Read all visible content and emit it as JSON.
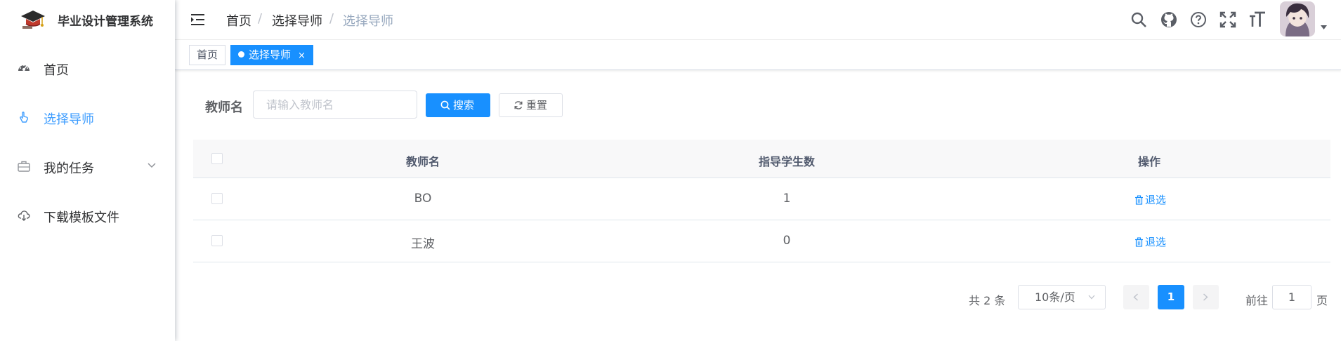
{
  "app": {
    "title": "毕业设计管理系统"
  },
  "sidebar": {
    "items": [
      {
        "label": "首页",
        "icon": "dashboard-icon",
        "active": false
      },
      {
        "label": "选择导师",
        "icon": "pointer-hand-icon",
        "active": true
      },
      {
        "label": "我的任务",
        "icon": "briefcase-icon",
        "active": false,
        "has_submenu": true
      },
      {
        "label": "下载模板文件",
        "icon": "cloud-download-icon",
        "active": false
      }
    ]
  },
  "breadcrumb": [
    "首页",
    "选择导师",
    "选择导师"
  ],
  "header_icons": [
    "search-icon",
    "github-icon",
    "help-circle-icon",
    "fullscreen-icon",
    "font-size-icon"
  ],
  "tags": [
    {
      "label": "首页",
      "active": false
    },
    {
      "label": "选择导师",
      "active": true,
      "close": "×"
    }
  ],
  "search": {
    "label": "教师名",
    "placeholder": "请输入教师名",
    "value": "",
    "search_button": "搜索",
    "reset_button": "重置"
  },
  "table": {
    "columns": [
      "教师名",
      "指导学生数",
      "操作"
    ],
    "rows": [
      {
        "teacher": "BO",
        "students": "1",
        "action": "退选"
      },
      {
        "teacher": "王波",
        "students": "0",
        "action": "退选"
      }
    ]
  },
  "pagination": {
    "total_text": "共 2 条",
    "page_size": "10条/页",
    "current_page": "1",
    "goto_prefix": "前往",
    "goto_value": "1",
    "goto_suffix": "页"
  },
  "colors": {
    "primary": "#1890ff",
    "active_menu": "#409eff",
    "header_bg": "#f8f8f9"
  }
}
